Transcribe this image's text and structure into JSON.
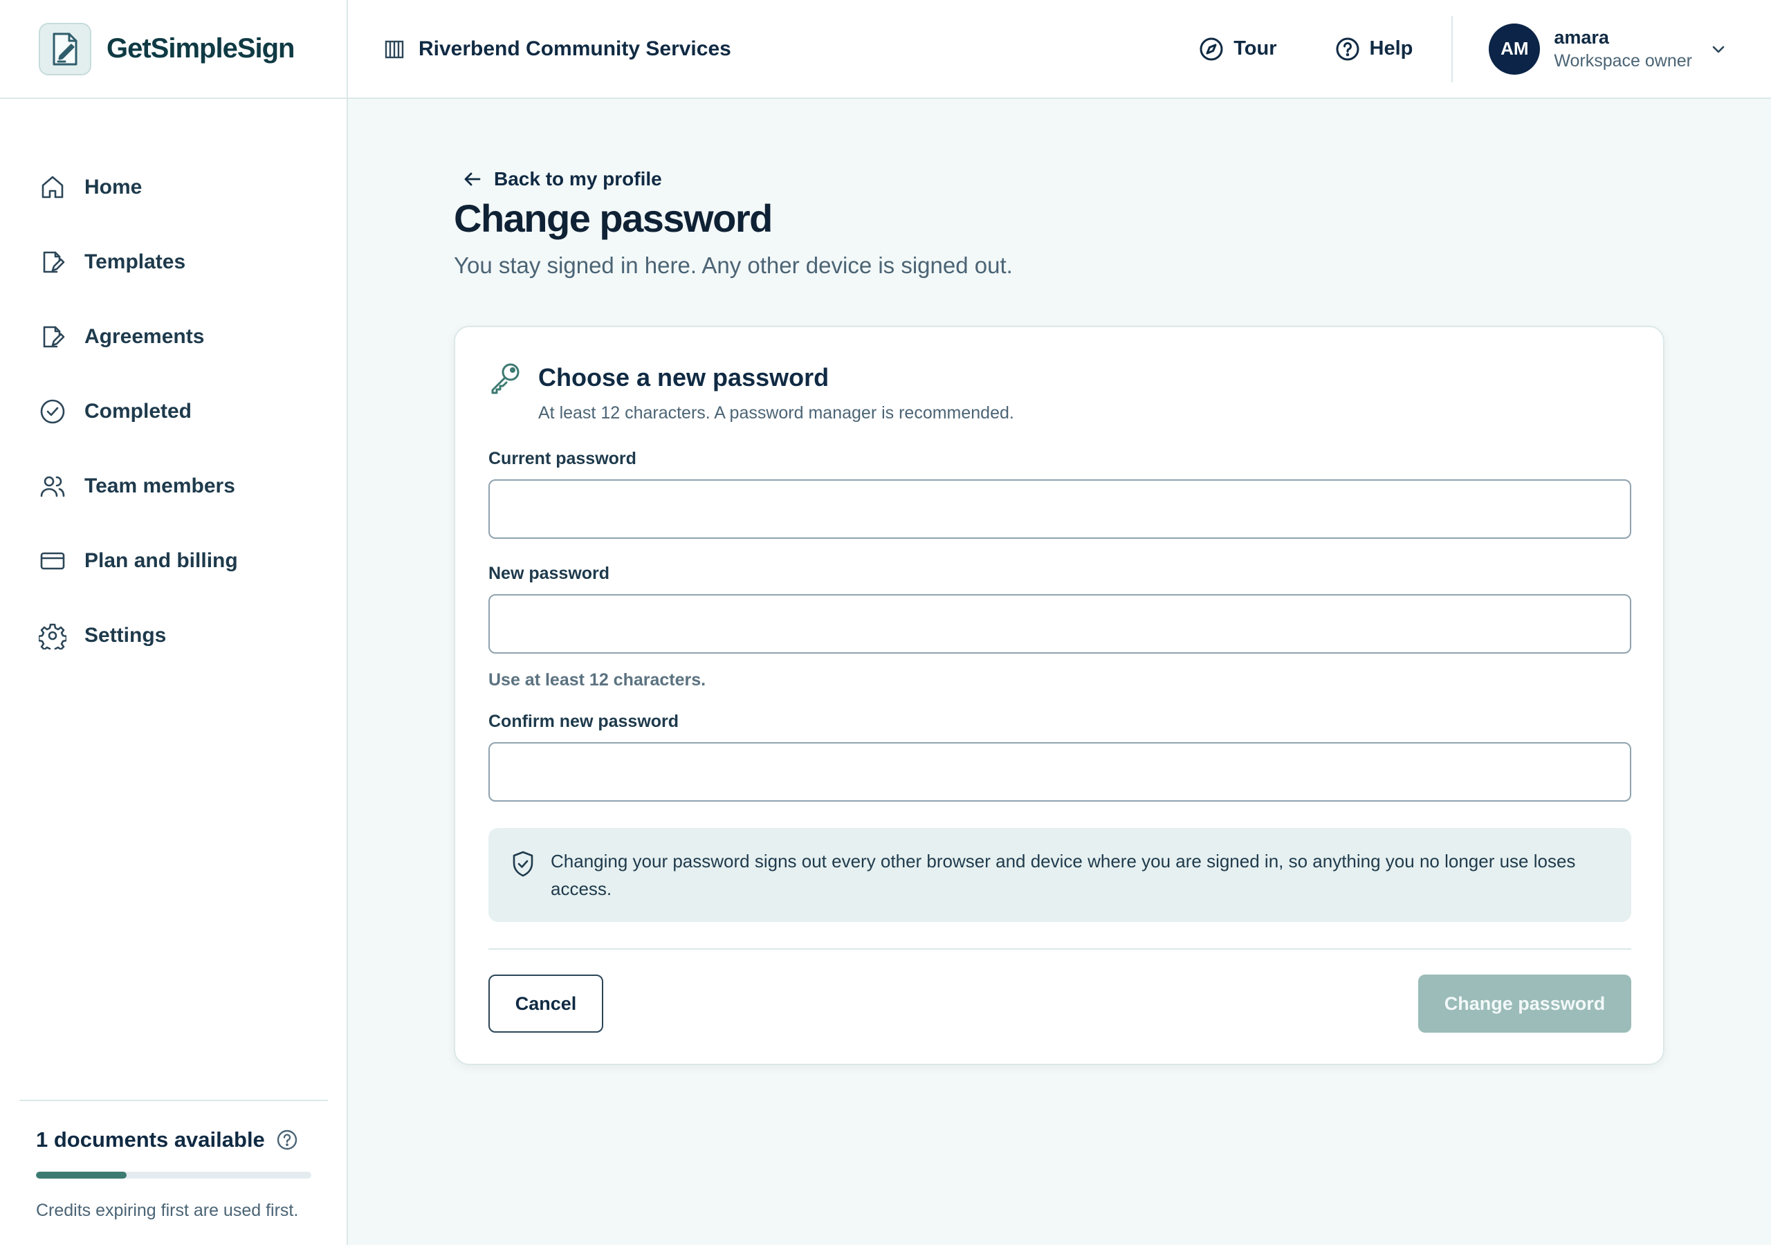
{
  "brand": {
    "name": "GetSimpleSign",
    "logo_icon": "document-pen-icon"
  },
  "header": {
    "organization": "Riverbend Community Services",
    "tour_label": "Tour",
    "help_label": "Help",
    "user": {
      "initials": "AM",
      "name": "amara",
      "role": "Workspace owner"
    }
  },
  "sidebar": {
    "items": [
      {
        "label": "Home",
        "icon": "home-icon"
      },
      {
        "label": "Templates",
        "icon": "template-icon"
      },
      {
        "label": "Agreements",
        "icon": "agreement-icon"
      },
      {
        "label": "Completed",
        "icon": "check-circle-icon"
      },
      {
        "label": "Team members",
        "icon": "users-icon"
      },
      {
        "label": "Plan and billing",
        "icon": "credit-card-icon"
      },
      {
        "label": "Settings",
        "icon": "gear-icon"
      }
    ],
    "footer": {
      "documents_available": "1 documents available",
      "usage_fraction": 0.33,
      "note": "Credits expiring first are used first."
    }
  },
  "page": {
    "back_label": "Back to my profile",
    "title": "Change password",
    "subtitle": "You stay signed in here. Any other device is signed out."
  },
  "card": {
    "title": "Choose a new password",
    "subtitle": "At least 12 characters. A password manager is recommended.",
    "fields": {
      "current": {
        "label": "Current password",
        "value": "",
        "placeholder": ""
      },
      "new": {
        "label": "New password",
        "value": "",
        "placeholder": "",
        "hint": "Use at least 12 characters."
      },
      "confirm": {
        "label": "Confirm new password",
        "value": "",
        "placeholder": ""
      }
    },
    "notice": "Changing your password signs out every other browser and device where you are signed in, so anything you no longer use loses access.",
    "cancel_label": "Cancel",
    "submit_label": "Change password"
  },
  "colors": {
    "accent": "#3d7a72",
    "navy": "#0b2447",
    "disabled_button": "#9bbcb9",
    "notice_background": "#e6f0f0",
    "page_background": "#f3f8f8"
  }
}
